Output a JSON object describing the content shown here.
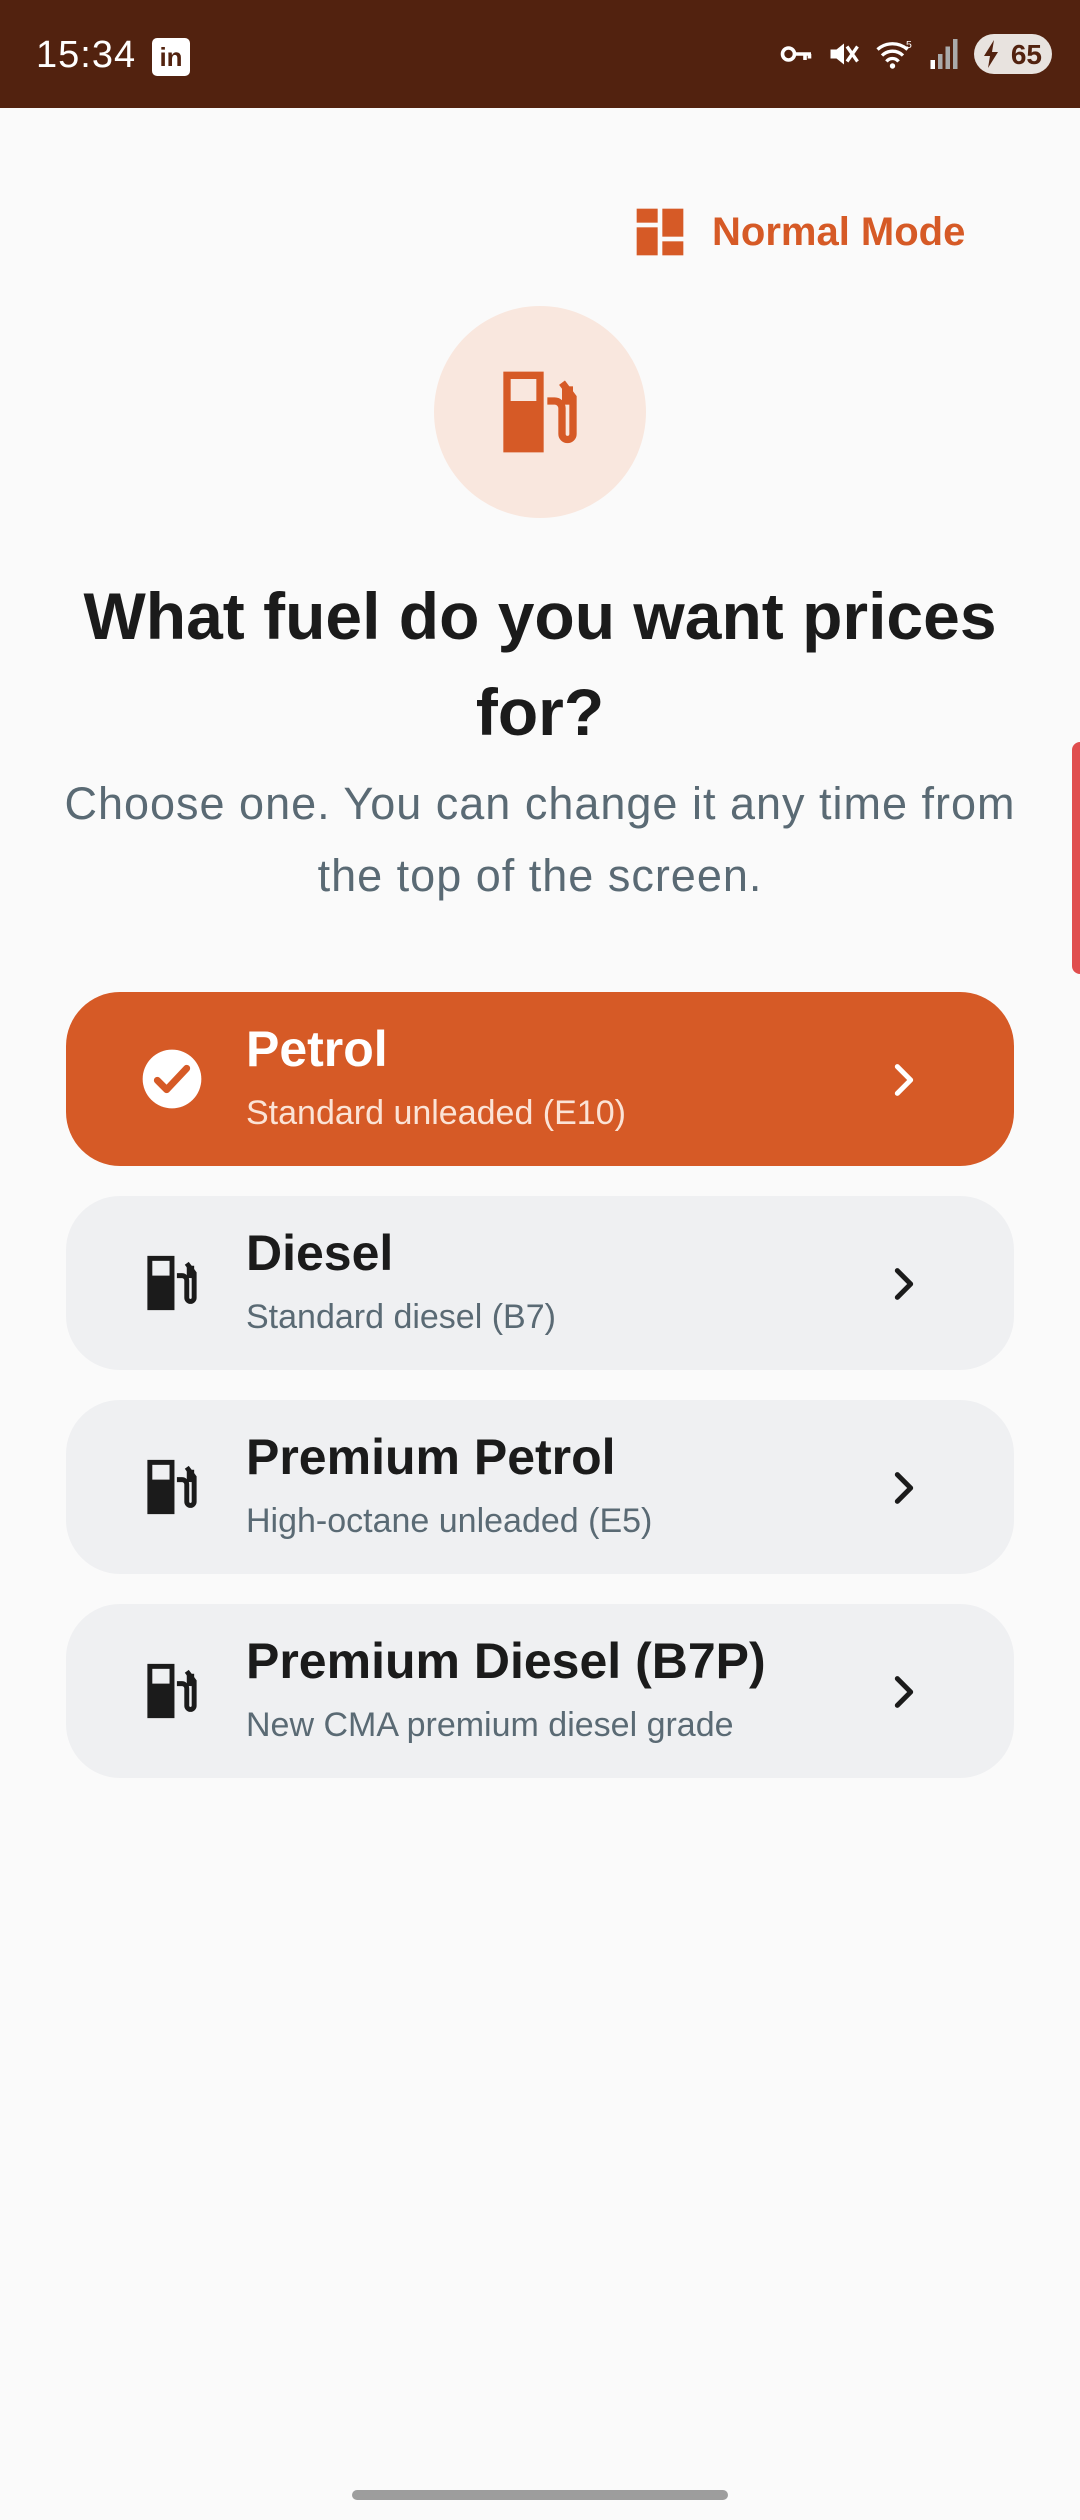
{
  "status_bar": {
    "time": "15:34",
    "linkedin_glyph": "in",
    "battery": "65",
    "icons": [
      "key-icon",
      "mute-icon",
      "wifi-icon",
      "signal-icon",
      "battery-charging-icon"
    ]
  },
  "mode_toggle": {
    "label": "Normal Mode",
    "icon": "dashboard-icon"
  },
  "hero": {
    "icon": "fuel-pump-icon"
  },
  "title": "What fuel do you want prices for?",
  "subtitle": "Choose one. You can change it any time from the top of the screen.",
  "options": [
    {
      "name": "Petrol",
      "description": "Standard unleaded (E10)",
      "selected": true,
      "icon": "check-circle-icon"
    },
    {
      "name": "Diesel",
      "description": "Standard diesel (B7)",
      "selected": false,
      "icon": "fuel-pump-icon"
    },
    {
      "name": "Premium Petrol",
      "description": "High-octane unleaded (E5)",
      "selected": false,
      "icon": "fuel-pump-icon"
    },
    {
      "name": "Premium Diesel (B7P)",
      "description": "New CMA premium diesel grade",
      "selected": false,
      "icon": "fuel-pump-icon"
    }
  ],
  "colors": {
    "accent": "#d65a26",
    "status_bar": "#52220f",
    "card": "#eff0f2",
    "hero_bg": "#f9e7de",
    "text": "#1b1b1b",
    "muted": "#5a6a74"
  }
}
